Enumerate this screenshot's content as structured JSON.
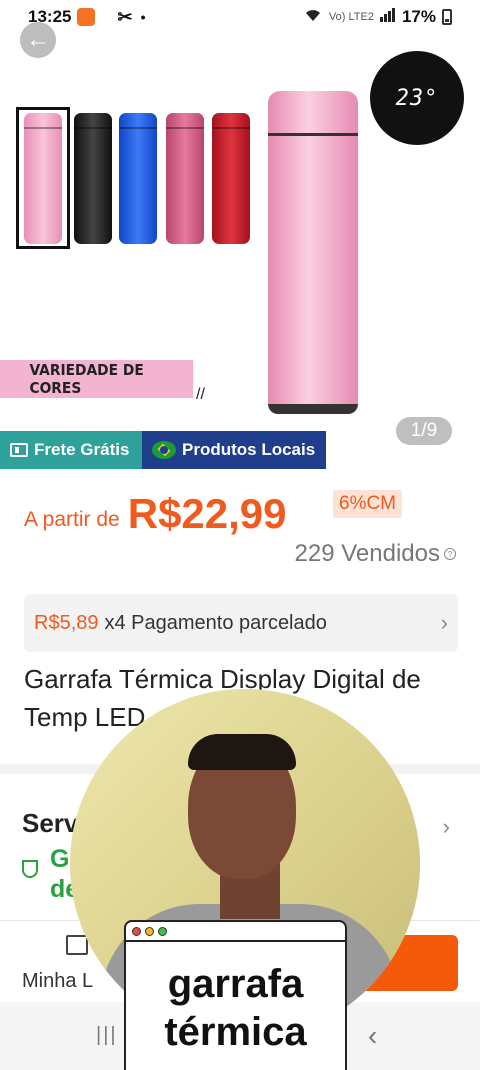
{
  "status_bar": {
    "time": "13:25",
    "network": "Vo) LTE2",
    "battery": "17%"
  },
  "gallery": {
    "display_temp": "23°",
    "banner_text": "VARIEDADE DE CORES",
    "counter": "1/9",
    "bottle_colors": [
      "#f4a6c7",
      "#1a1a1a",
      "#1f5fe0",
      "#d35c88",
      "#c4202b"
    ]
  },
  "badges": {
    "free_shipping": "Frete Grátis",
    "local_products": "Produtos Locais"
  },
  "price": {
    "prefix": "A partir de",
    "value": "R$22,99",
    "discount": "6%CM",
    "sold": "229 Vendidos"
  },
  "installment": {
    "amount": "R$5,89",
    "text": "x4 Pagamento parcelado"
  },
  "product": {
    "title": "Garrafa Térmica Display Digital de Temp                LED"
  },
  "service": {
    "title": "Serv",
    "subtitle_line1": "G",
    "subtitle_line2": "de"
  },
  "action_bar": {
    "store_label": "Minha L"
  },
  "caption": {
    "line1": "garrafa",
    "line2": "térmica"
  },
  "colors": {
    "accent": "#f05a1e",
    "badge_free": "#2ea19a",
    "badge_local": "#1f3f8c",
    "success": "#29a13f"
  }
}
